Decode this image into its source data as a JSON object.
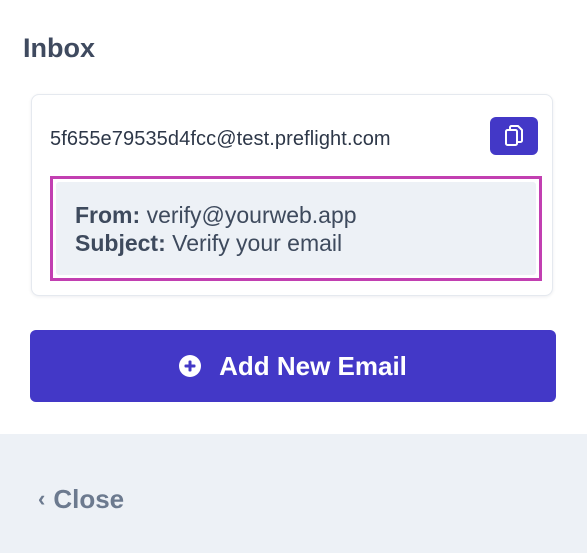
{
  "inbox": {
    "title": "Inbox",
    "address": "5f655e79535d4fcc@test.preflight.com",
    "copy_icon": "copy-icon",
    "messages": [
      {
        "from_label": "From:",
        "from_value": "verify@yourweb.app",
        "subject_label": "Subject:",
        "subject_value": "Verify your email"
      }
    ],
    "highlight_color": "#c23fb1"
  },
  "actions": {
    "add_email_label": "Add New Email",
    "add_email_icon": "plus-circle-icon",
    "close_label": "Close",
    "close_icon": "chevron-left-icon"
  },
  "colors": {
    "accent": "#4338c7",
    "text": "#3f4a5f",
    "muted": "#6c7a8f",
    "panel_bg": "#edf1f6"
  }
}
